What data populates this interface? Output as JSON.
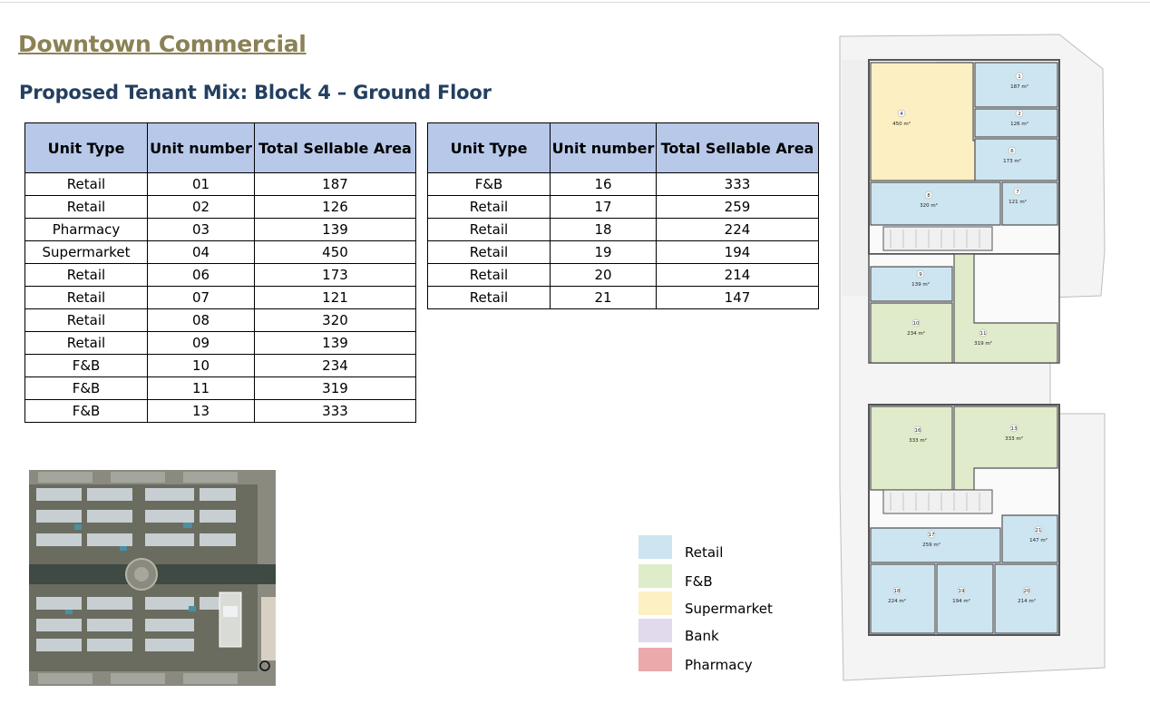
{
  "page": {
    "title": "Downtown Commercial",
    "subtitle": "Proposed Tenant Mix: Block 4 – Ground Floor"
  },
  "tables": {
    "headers": [
      "Unit Type",
      "Unit number",
      "Total Sellable Area"
    ],
    "left_rows": [
      [
        "Retail",
        "01",
        "187"
      ],
      [
        "Retail",
        "02",
        "126"
      ],
      [
        "Pharmacy",
        "03",
        "139"
      ],
      [
        "Supermarket",
        "04",
        "450"
      ],
      [
        "Retail",
        "06",
        "173"
      ],
      [
        "Retail",
        "07",
        "121"
      ],
      [
        "Retail",
        "08",
        "320"
      ],
      [
        "Retail",
        "09",
        "139"
      ],
      [
        "F&B",
        "10",
        "234"
      ],
      [
        "F&B",
        "11",
        "319"
      ],
      [
        "F&B",
        "13",
        "333"
      ]
    ],
    "right_rows": [
      [
        "F&B",
        "16",
        "333"
      ],
      [
        "Retail",
        "17",
        "259"
      ],
      [
        "Retail",
        "18",
        "224"
      ],
      [
        "Retail",
        "19",
        "194"
      ],
      [
        "Retail",
        "20",
        "214"
      ],
      [
        "Retail",
        "21",
        "147"
      ]
    ]
  },
  "legend": [
    {
      "label": "Retail",
      "color": "#cce5f0"
    },
    {
      "label": "F&B",
      "color": "#dfecc9"
    },
    {
      "label": "Supermarket",
      "color": "#fdf1c3"
    },
    {
      "label": "Bank",
      "color": "#e1d9ec"
    },
    {
      "label": "Pharmacy",
      "color": "#eaa9ab"
    }
  ],
  "floor_plan": {
    "colors": {
      "retail": "#cde5f1",
      "fnb": "#dfebca",
      "supermarket": "#fcefc2",
      "pharmacy": "#e8aaaa",
      "wall": "#555555"
    },
    "units": [
      {
        "id": "1",
        "area": "187 m²",
        "type": "retail"
      },
      {
        "id": "2",
        "area": "126 m²",
        "type": "retail"
      },
      {
        "id": "3",
        "area": "139 m²",
        "type": "pharmacy"
      },
      {
        "id": "4",
        "area": "450 m²",
        "type": "supermarket"
      },
      {
        "id": "6",
        "area": "173 m²",
        "type": "retail"
      },
      {
        "id": "7",
        "area": "121 m²",
        "type": "retail"
      },
      {
        "id": "8",
        "area": "320 m²",
        "type": "retail"
      },
      {
        "id": "9",
        "area": "139 m²",
        "type": "retail"
      },
      {
        "id": "10",
        "area": "234 m²",
        "type": "fnb"
      },
      {
        "id": "11",
        "area": "319 m²",
        "type": "fnb"
      },
      {
        "id": "16",
        "area": "333 m²",
        "type": "fnb"
      },
      {
        "id": "13",
        "area": "333 m²",
        "type": "fnb"
      },
      {
        "id": "17",
        "area": "259 m²",
        "type": "retail"
      },
      {
        "id": "21",
        "area": "147 m²",
        "type": "retail"
      },
      {
        "id": "18",
        "area": "224 m²",
        "type": "retail"
      },
      {
        "id": "19",
        "area": "194 m²",
        "type": "retail"
      },
      {
        "id": "20",
        "area": "214 m²",
        "type": "retail"
      }
    ]
  },
  "aerial": {
    "icon": "compass-icon"
  }
}
